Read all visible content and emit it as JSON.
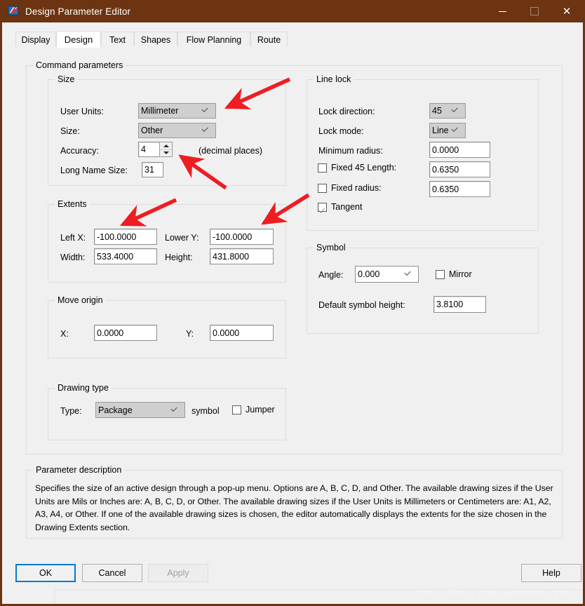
{
  "window": {
    "title": "Design Parameter Editor",
    "icon": "app-flag-icon",
    "titlebar_color": "#6c3410",
    "controls": {
      "minimize": "–",
      "maximize": "□",
      "close": "✕"
    }
  },
  "tabs": [
    {
      "label": "Display",
      "active": false
    },
    {
      "label": "Design",
      "active": true
    },
    {
      "label": "Text",
      "active": false
    },
    {
      "label": "Shapes",
      "active": false
    },
    {
      "label": "Flow Planning",
      "active": false
    },
    {
      "label": "Route",
      "active": false
    }
  ],
  "command_parameters": {
    "legend": "Command parameters"
  },
  "size_group": {
    "legend": "Size",
    "user_units": {
      "label": "User Units:",
      "value": "Millimeter"
    },
    "size": {
      "label": "Size:",
      "value": "Other"
    },
    "accuracy": {
      "label": "Accuracy:",
      "value": "4",
      "suffix": "(decimal places)"
    },
    "long_name_size": {
      "label": "Long Name Size:",
      "value": "31"
    }
  },
  "extents_group": {
    "legend": "Extents",
    "left_x": {
      "label": "Left X:",
      "value": "-100.0000"
    },
    "lower_y": {
      "label": "Lower Y:",
      "value": "-100.0000"
    },
    "width": {
      "label": "Width:",
      "value": "533.4000"
    },
    "height": {
      "label": "Height:",
      "value": "431.8000"
    }
  },
  "move_origin_group": {
    "legend": "Move origin",
    "x": {
      "label": "X:",
      "value": "0.0000"
    },
    "y": {
      "label": "Y:",
      "value": "0.0000"
    }
  },
  "drawing_type_group": {
    "legend": "Drawing type",
    "type": {
      "label": "Type:",
      "value": "Package"
    },
    "symbol_text": "symbol",
    "jumper": {
      "label": "Jumper",
      "checked": false
    }
  },
  "line_lock_group": {
    "legend": "Line lock",
    "lock_direction": {
      "label": "Lock direction:",
      "value": "45"
    },
    "lock_mode": {
      "label": "Lock mode:",
      "value": "Line"
    },
    "minimum_radius": {
      "label": "Minimum radius:",
      "value": "0.0000"
    },
    "fixed_45_length": {
      "label": "Fixed 45 Length:",
      "value": "0.6350",
      "checked": false
    },
    "fixed_radius": {
      "label": "Fixed radius:",
      "value": "0.6350",
      "checked": false
    },
    "tangent": {
      "label": "Tangent",
      "checked": true
    }
  },
  "symbol_group": {
    "legend": "Symbol",
    "angle": {
      "label": "Angle:",
      "value": "0.000"
    },
    "mirror": {
      "label": "Mirror",
      "checked": false
    },
    "default_symbol_height": {
      "label": "Default symbol height:",
      "value": "3.8100"
    }
  },
  "parameter_description": {
    "legend": "Parameter description",
    "text": "Specifies the size of an active design through a pop-up menu. Options are A, B, C, D, and Other.  The available drawing sizes if the User Units are Mils or Inches are: A, B, C, D, or Other.  The available drawing sizes if the User Units is Millimeters or Centimeters are: A1, A2, A3, A4, or Other. If one of the available drawing sizes is chosen, the editor automatically displays the extents for the size chosen in the Drawing Extents section."
  },
  "footer": {
    "ok": "OK",
    "cancel": "Cancel",
    "apply": "Apply",
    "apply_disabled": true,
    "help": "Help"
  },
  "watermark": {
    "text": "https://blog.csdn.net/WHL_YSU"
  },
  "annotations": {
    "accent_color": "#ee1d23",
    "arrow_count": 4,
    "arrow_targets": [
      "user-units-combo",
      "accuracy-spinner",
      "left-x-field",
      "lower-y-field"
    ]
  }
}
